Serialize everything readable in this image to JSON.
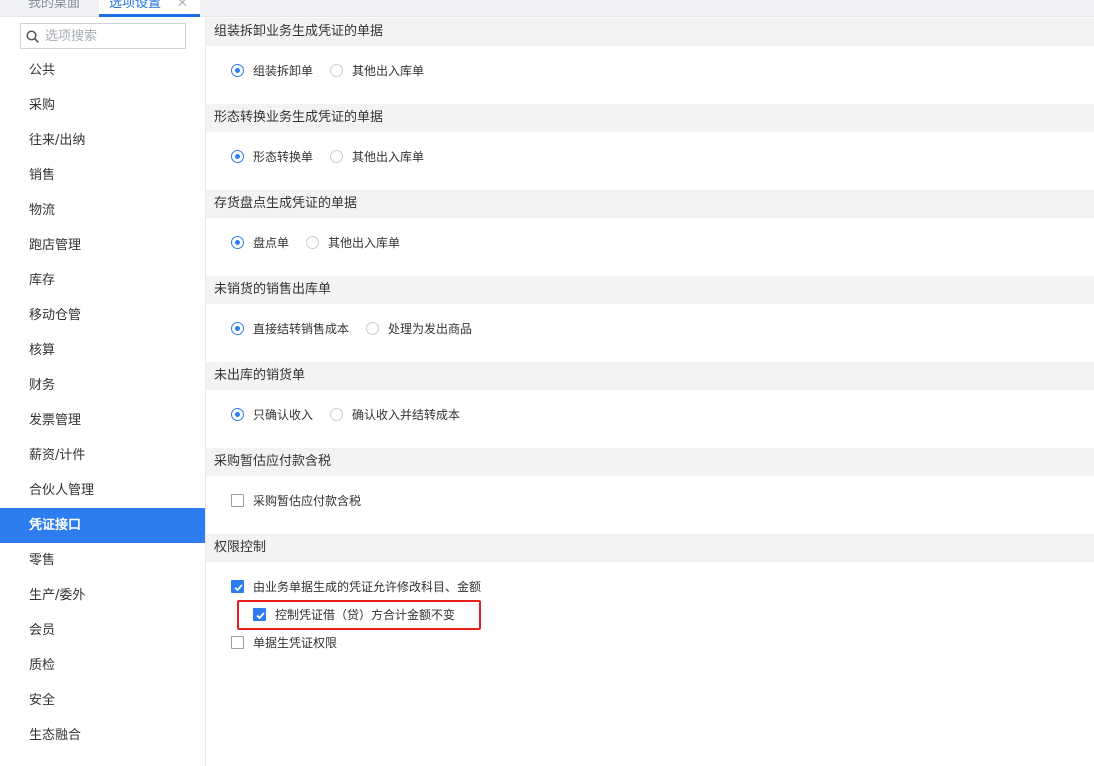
{
  "tabs": [
    {
      "label": "我的桌面"
    },
    {
      "label": "选项设置",
      "close": "✕"
    }
  ],
  "search": {
    "placeholder": "选项搜索"
  },
  "sidebar": {
    "items": [
      {
        "label": "公共"
      },
      {
        "label": "采购"
      },
      {
        "label": "往来/出纳"
      },
      {
        "label": "销售"
      },
      {
        "label": "物流"
      },
      {
        "label": "跑店管理"
      },
      {
        "label": "库存"
      },
      {
        "label": "移动仓管"
      },
      {
        "label": "核算"
      },
      {
        "label": "财务"
      },
      {
        "label": "发票管理"
      },
      {
        "label": "薪资/计件"
      },
      {
        "label": "合伙人管理"
      },
      {
        "label": "凭证接口",
        "active": true
      },
      {
        "label": "零售"
      },
      {
        "label": "生产/委外"
      },
      {
        "label": "会员"
      },
      {
        "label": "质检"
      },
      {
        "label": "安全"
      },
      {
        "label": "生态融合"
      }
    ]
  },
  "sections": [
    {
      "title": "组装拆卸业务生成凭证的单据",
      "options": [
        "组装拆卸单",
        "其他出入库单"
      ],
      "selected": 0
    },
    {
      "title": "形态转换业务生成凭证的单据",
      "options": [
        "形态转换单",
        "其他出入库单"
      ],
      "selected": 0
    },
    {
      "title": "存货盘点生成凭证的单据",
      "options": [
        "盘点单",
        "其他出入库单"
      ],
      "selected": 0
    },
    {
      "title": "未销货的销售出库单",
      "options": [
        "直接结转销售成本",
        "处理为发出商品"
      ],
      "selected": 0
    },
    {
      "title": "未出库的销货单",
      "options": [
        "只确认收入",
        "确认收入并结转成本"
      ],
      "selected": 0
    },
    {
      "title": "采购暂估应付款含税",
      "checkbox": {
        "label": "采购暂估应付款含税",
        "checked": false
      }
    },
    {
      "title": "权限控制",
      "checkboxes": [
        {
          "label": "由业务单据生成的凭证允许修改科目、金额",
          "checked": true
        },
        {
          "label": "控制凭证借（贷）方合计金额不变",
          "checked": true
        },
        {
          "label": "单据生凭证权限",
          "checked": false
        }
      ]
    }
  ],
  "colors": {
    "accent": "#2d7cf0",
    "highlight": "#e5201f",
    "section_bg": "#f2f3f5"
  }
}
